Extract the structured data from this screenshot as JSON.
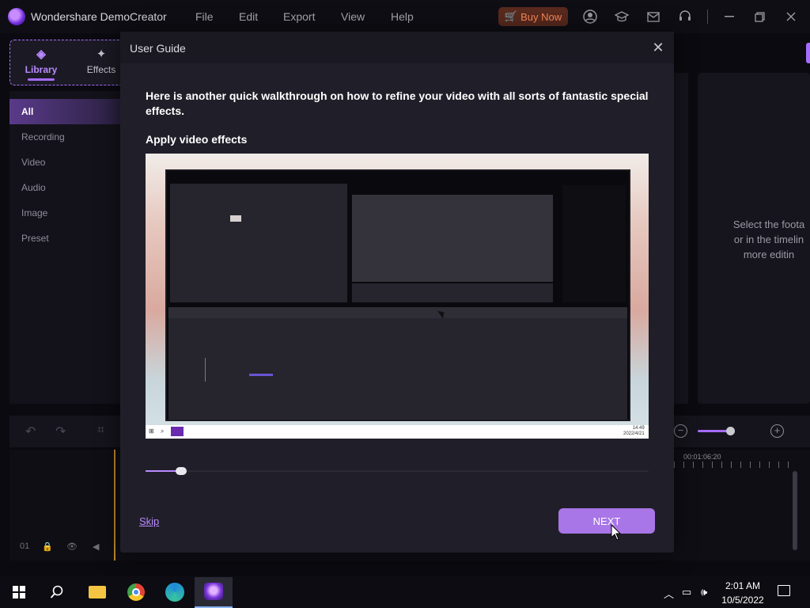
{
  "app": {
    "title": "Wondershare DemoCreator",
    "menu": [
      "File",
      "Edit",
      "Export",
      "View",
      "Help"
    ],
    "buy_now": "Buy Now"
  },
  "library": {
    "tabs": [
      {
        "label": "Library",
        "icon": "layers-icon",
        "active": true
      },
      {
        "label": "Effects",
        "icon": "sparkle-icon",
        "active": false
      }
    ],
    "categories": [
      "All",
      "Recording",
      "Video",
      "Audio",
      "Image",
      "Preset"
    ],
    "active_category": "All"
  },
  "right_panel": {
    "hint_lines": [
      "Select the foota",
      "or in the timelin",
      "more editin"
    ]
  },
  "timeline": {
    "time_label": "00:01:06:20",
    "track_number": "01"
  },
  "modal": {
    "title": "User Guide",
    "description": "Here is another quick walkthrough on how to refine your video with all sorts of fantastic special effects.",
    "subtitle": "Apply video effects",
    "progress": 0.07,
    "skip_label": "Skip",
    "next_label": "NEXT",
    "video_clock": [
      "14:49",
      "2022/4/21"
    ]
  },
  "taskbar": {
    "time": "2:01 AM",
    "date": "10/5/2022"
  },
  "colors": {
    "accent": "#a66cff",
    "next_button": "#a876e6",
    "buy_now_text": "#ff8a5b"
  }
}
